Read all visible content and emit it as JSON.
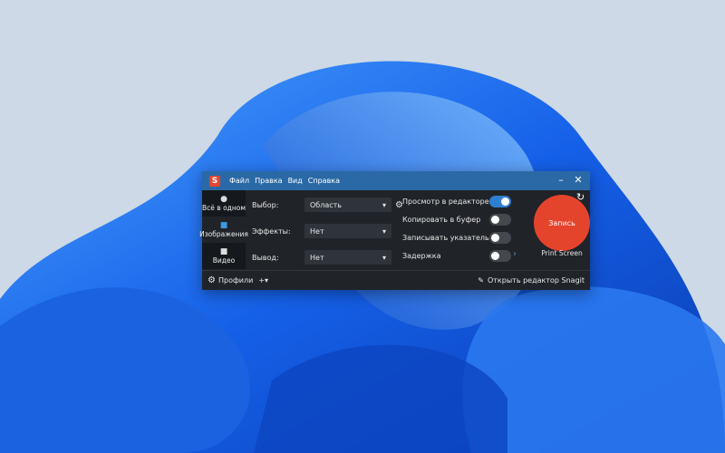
{
  "app": {
    "logo": "S",
    "menu": [
      "Файл",
      "Правка",
      "Вид",
      "Справка"
    ],
    "minimize": "–",
    "close": "✕"
  },
  "tabs": [
    {
      "label": "Всё в одном",
      "icon": "●"
    },
    {
      "label": "Изображения",
      "icon": "■"
    },
    {
      "label": "Видео",
      "icon": "■"
    }
  ],
  "settings": [
    {
      "label": "Выбор:",
      "value": "Область"
    },
    {
      "label": "Эффекты:",
      "value": "Нет"
    },
    {
      "label": "Вывод:",
      "value": "Нет"
    }
  ],
  "options": [
    {
      "label": "Просмотр в редакторе",
      "on": true
    },
    {
      "label": "Копировать в буфер",
      "on": false
    },
    {
      "label": "Записывать указатель",
      "on": false
    },
    {
      "label": "Задержка",
      "on": false
    }
  ],
  "capture": {
    "label": "Запись",
    "hotkey": "Print Screen",
    "reset": "↻"
  },
  "bottom": {
    "profiles": "Профили",
    "add": "+▾",
    "open_editor": "Открыть редактор Snagit"
  },
  "colors": {
    "accent": "#2a69a6",
    "record": "#e5442c"
  }
}
